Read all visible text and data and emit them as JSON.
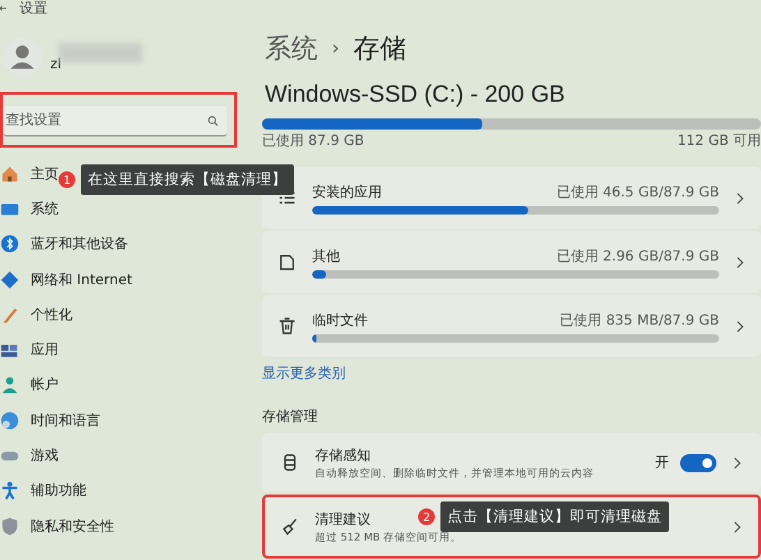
{
  "window": {
    "title": "设置"
  },
  "profile": {
    "name": "zl"
  },
  "search": {
    "placeholder": "查找设置",
    "highlighted": true
  },
  "nav": [
    {
      "label": "主页"
    },
    {
      "label": "系统"
    },
    {
      "label": "蓝牙和其他设备"
    },
    {
      "label": "网络和 Internet"
    },
    {
      "label": "个性化"
    },
    {
      "label": "应用"
    },
    {
      "label": "帐户"
    },
    {
      "label": "时间和语言"
    },
    {
      "label": "游戏"
    },
    {
      "label": "辅助功能"
    },
    {
      "label": "隐私和安全性"
    }
  ],
  "breadcrumb": {
    "parent": "系统",
    "separator": "›",
    "current": "存储"
  },
  "drive": {
    "title": "Windows-SSD (C:) - 200 GB",
    "level": 0.44,
    "used": "已使用 87.9 GB",
    "free": "112 GB 可用"
  },
  "categories": [
    {
      "label": "安装的应用",
      "reading": "已使用 46.5 GB/87.9 GB",
      "level": 0.53
    },
    {
      "label": "其他",
      "reading": "已使用 2.96 GB/87.9 GB",
      "level": 0.034
    },
    {
      "label": "临时文件",
      "reading": "已使用 835 MB/87.9 GB",
      "level": 0.01
    }
  ],
  "more_link": "显示更多类别",
  "management": {
    "heading": "存储管理",
    "items": [
      {
        "kind": "toggle",
        "title": "存储感知",
        "description": "自动释放空间、删除临时文件，并管理本地可用的云内容",
        "toggle_label": "开",
        "on": true,
        "highlighted": false
      },
      {
        "kind": "link",
        "title": "清理建议",
        "description": "超过 512 MB 存储空间可用。",
        "highlighted": true
      }
    ]
  },
  "annotations": [
    {
      "number": "1",
      "text": "在这里直接搜索【磁盘清理】"
    },
    {
      "number": "2",
      "text": "点击【清理建议】即可清理磁盘"
    }
  ]
}
